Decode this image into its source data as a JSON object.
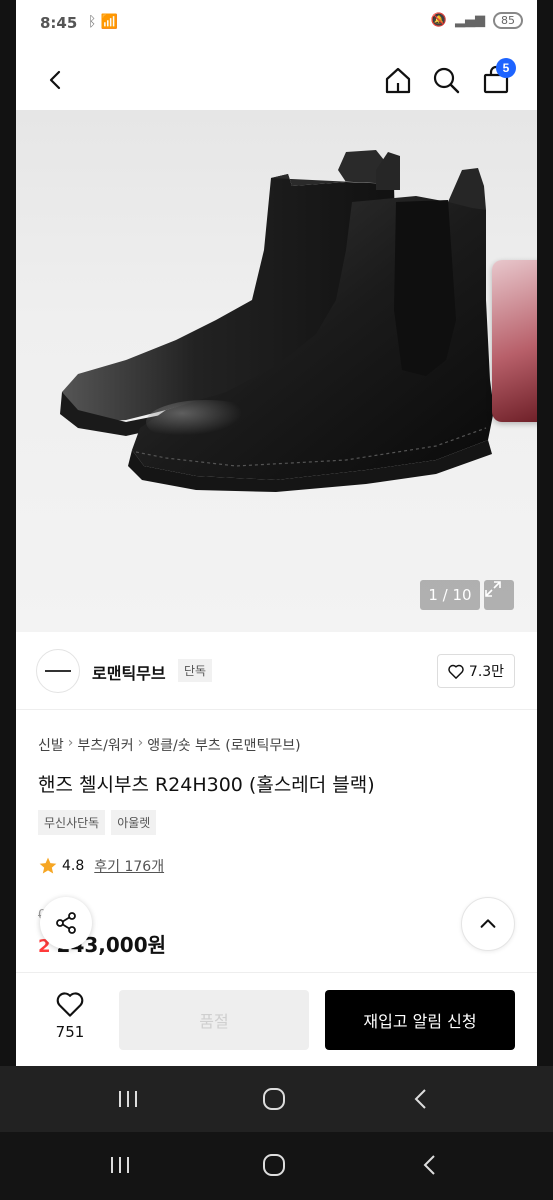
{
  "status_bar": {
    "time": "8:45",
    "left_icons": "ᛒ 📶",
    "battery": "85"
  },
  "header": {
    "back_icon": "chevron-left-icon",
    "home_icon": "home-icon",
    "search_icon": "search-icon",
    "cart_icon": "shopping-bag-icon",
    "cart_count": "5"
  },
  "gallery": {
    "counter": "1 / 10",
    "expand_icon": "expand-icon"
  },
  "brand": {
    "name": "로맨틱무브",
    "tag": "단독",
    "likes": "7.3만"
  },
  "breadcrumb": [
    "신발",
    "부츠/워커",
    "앵클/숏 부츠 (로맨틱무브)"
  ],
  "product": {
    "title": "핸즈 첼시부츠 R24H300 (홀스레더 블랙)",
    "tags": [
      "무신사단독",
      "아울렛"
    ],
    "rating": "4.8",
    "review_label": "후기 176개",
    "original_price": "00원",
    "discount": "2",
    "price": "243,000원"
  },
  "bottom_bar": {
    "wish_count": "751",
    "soldout_label": "품절",
    "restock_label": "재입고 알림 신청"
  },
  "colors": {
    "accent_blue": "#1e64ff",
    "discount_red": "#ff3b3b",
    "star": "#f6a623"
  }
}
